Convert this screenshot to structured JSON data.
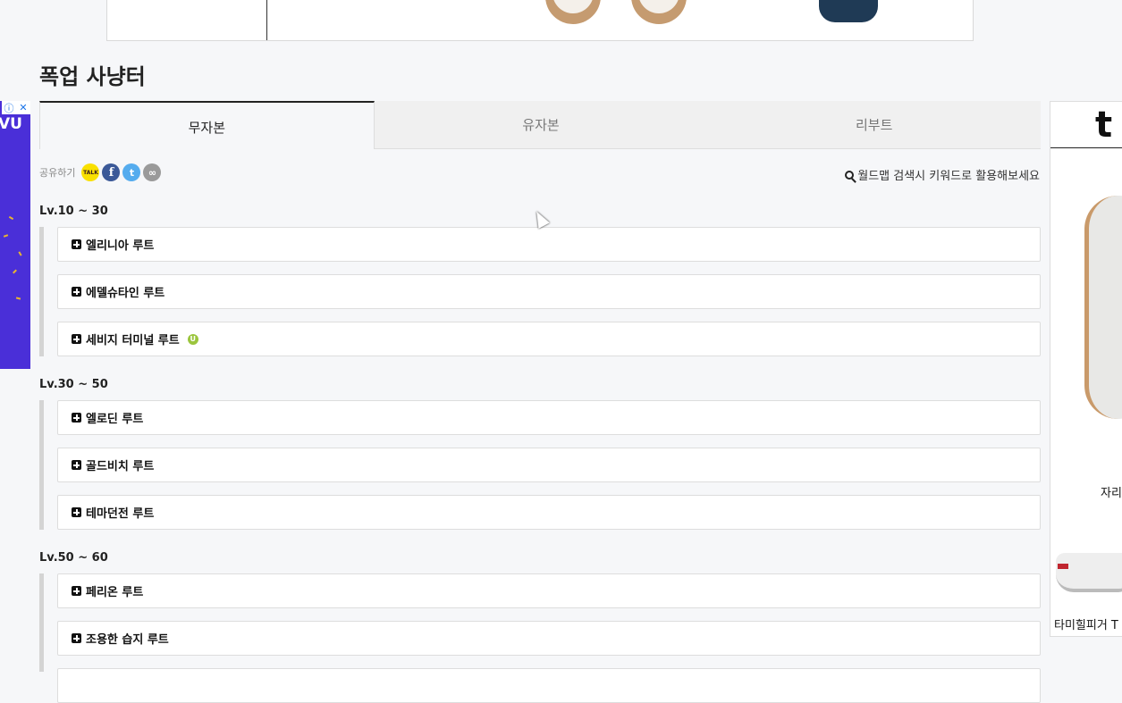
{
  "page_title": "폭업 사냥터",
  "tabs": [
    {
      "label": "무자본",
      "active": true
    },
    {
      "label": "유자본",
      "active": false
    },
    {
      "label": "리부트",
      "active": false
    }
  ],
  "share": {
    "label": "공유하기",
    "icons": [
      "kakaotalk-icon",
      "facebook-icon",
      "twitter-icon",
      "link-icon"
    ],
    "kakao_text": "TALK",
    "fb_text": "f",
    "tw_text": "t",
    "link_text": "∞"
  },
  "search_tip": "월드맵 검색시 키워드로 활용해보세요",
  "groups": [
    {
      "title": "Lv.10 ~ 30",
      "routes": [
        "엘리니아 루트",
        "에델슈타인 루트",
        "세비지 터미널 루트"
      ]
    },
    {
      "title": "Lv.30 ~ 50",
      "routes": [
        "엘로딘 루트",
        "골드비치 루트",
        "테마던전 루트"
      ]
    },
    {
      "title": "Lv.50 ~ 60",
      "routes": [
        "페리온 루트",
        "조용한 습지 루트"
      ]
    }
  ],
  "badge_u": "U",
  "left_ad": {
    "text": "VU",
    "info": "ⓘ",
    "close": "✕"
  },
  "right_ad": {
    "brand": "t",
    "caption1": "자리",
    "caption2": "타미힐피거 T"
  },
  "colors": {
    "ad_purple": "#4a2fd8",
    "badge_green": "#9bc53d",
    "kakao_yellow": "#f9e000",
    "facebook_blue": "#3b5998",
    "twitter_blue": "#55acee"
  }
}
